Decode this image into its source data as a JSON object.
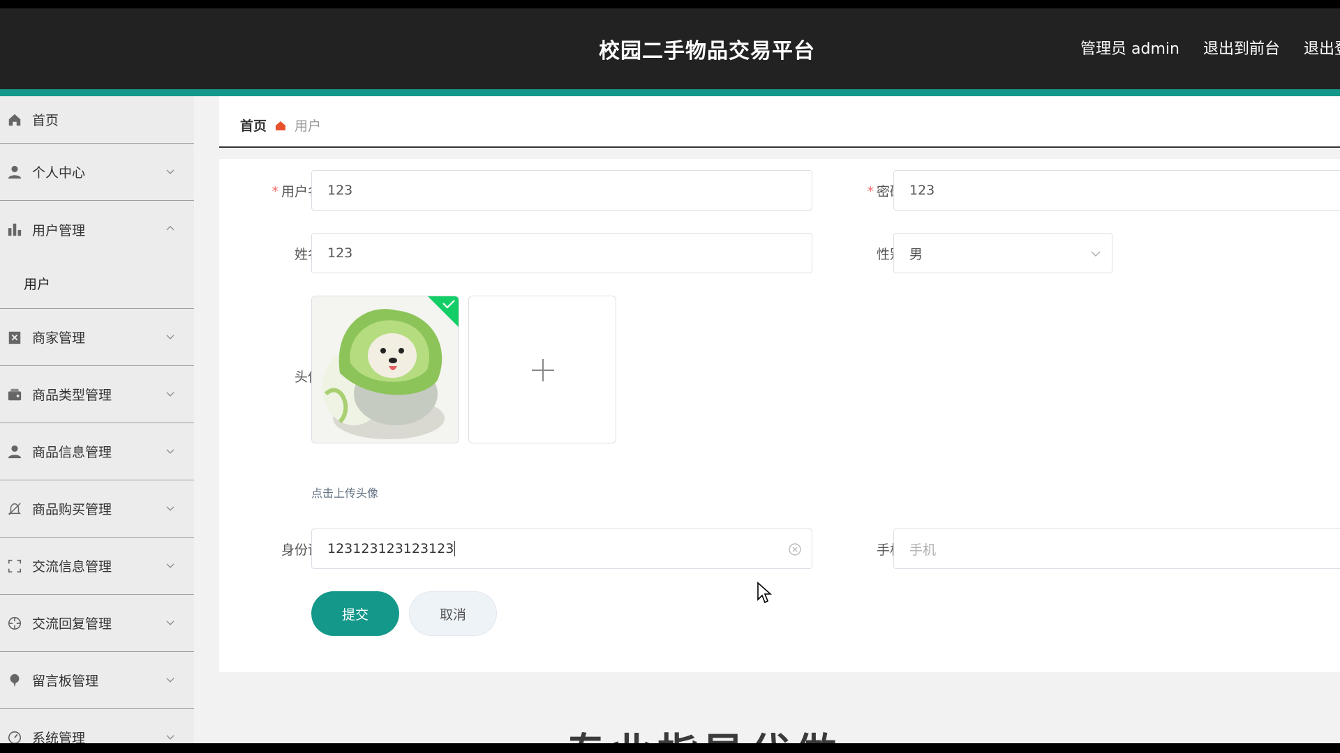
{
  "header": {
    "title": "校园二手物品交易平台",
    "user_label": "管理员 admin",
    "front_link": "退出到前台",
    "logout_link": "退出登录"
  },
  "colors": {
    "accent": "#14988a",
    "header_bg": "#222222",
    "required": "#f56c6c"
  },
  "sidebar": {
    "items": [
      {
        "label": "首页",
        "icon": "home-icon"
      },
      {
        "label": "个人中心",
        "icon": "user-icon"
      },
      {
        "label": "用户管理",
        "icon": "bar-chart-icon",
        "expanded": true,
        "children": [
          {
            "label": "用户"
          }
        ]
      },
      {
        "label": "商家管理",
        "icon": "clipboard-icon"
      },
      {
        "label": "商品类型管理",
        "icon": "wallet-icon"
      },
      {
        "label": "商品信息管理",
        "icon": "user-icon"
      },
      {
        "label": "商品购买管理",
        "icon": "bell-icon"
      },
      {
        "label": "交流信息管理",
        "icon": "expand-icon"
      },
      {
        "label": "交流回复管理",
        "icon": "aperture-icon"
      },
      {
        "label": "留言板管理",
        "icon": "pin-icon"
      },
      {
        "label": "系统管理",
        "icon": "gauge-icon"
      }
    ]
  },
  "breadcrumb": {
    "home": "首页",
    "current": "用户"
  },
  "form": {
    "username": {
      "label": "用户名",
      "value": "123"
    },
    "password": {
      "label": "密码",
      "value": "123"
    },
    "name": {
      "label": "姓名",
      "value": "123"
    },
    "gender": {
      "label": "性别",
      "value": "男"
    },
    "avatar": {
      "label": "头像",
      "tip": "点击上传头像"
    },
    "idcard": {
      "label": "身份证",
      "value": "123123123123123"
    },
    "phone": {
      "label": "手机",
      "placeholder": "手机"
    },
    "submit_label": "提交",
    "cancel_label": "取消"
  },
  "watermark": "专业指导代做"
}
